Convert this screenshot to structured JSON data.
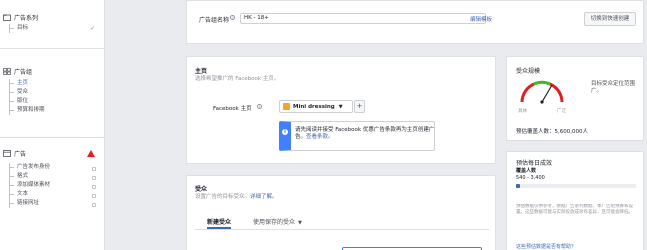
{
  "sidebar": {
    "campaign": {
      "title": "广告系列",
      "items": [
        {
          "label": "目标"
        }
      ]
    },
    "adset": {
      "title": "广告组",
      "items": [
        {
          "label": "主页"
        },
        {
          "label": "受众"
        },
        {
          "label": "版位"
        },
        {
          "label": "预算和排期"
        }
      ]
    },
    "ad": {
      "title": "广告",
      "items": [
        {
          "label": "广告发布身份"
        },
        {
          "label": "格式"
        },
        {
          "label": "添加媒体素材"
        },
        {
          "label": "文本"
        },
        {
          "label": "链接网址"
        }
      ]
    }
  },
  "header": {
    "name_label": "广告组名称",
    "name_value": "HK - 18+",
    "template_link": "编辑模板",
    "quick_create_button": "切换到快速创建"
  },
  "page_section": {
    "title": "主页",
    "description": "选择希望推广的 Facebook 主页。",
    "field_label": "Facebook 主页",
    "selected_page": "Mini dressing",
    "add_button": "+",
    "notice_text": "请先阅读并接受 Facebook 优惠广告条款再为主页创建广告。",
    "notice_link": "查看条款。"
  },
  "audience_section": {
    "title": "受众",
    "description": "设置广告的目标受众。",
    "learn_more": "详细了解。",
    "tab_new": "新建受众",
    "tab_saved": "使用保存的受众"
  },
  "audience_size": {
    "title": "受众规模",
    "gauge_note": "目标受众定位范围广。",
    "narrow_label": "具体",
    "broad_label": "广泛",
    "reach_text": "预估覆盖人数：5,600,000人"
  },
  "daily_results": {
    "title": "预估每日成效",
    "reach_label": "覆盖人数",
    "reach_range": "540 - 3,400",
    "reach_fill": 0.03,
    "disclaimer": "预估数据仅供参考，依据广告系列数据、本广告组预算和设置。这些数据可能与实际投放成效有差异，且可能会降低。",
    "helpful_link": "这些预估数据是否有帮助？"
  }
}
